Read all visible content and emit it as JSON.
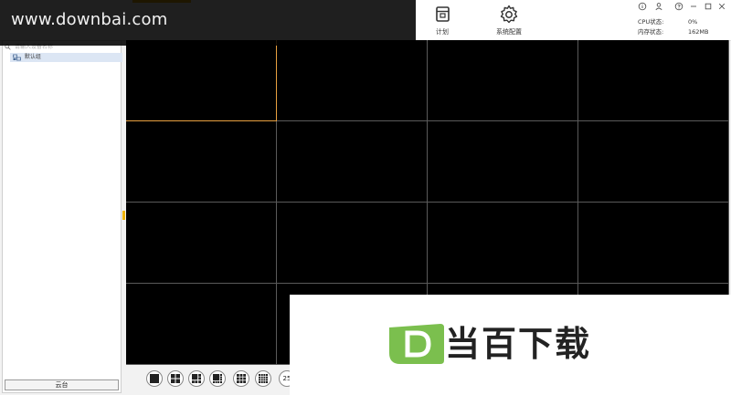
{
  "watermark": {
    "url_text": "www.downbai.com",
    "logo_letter": "D",
    "logo_text": "当百下载"
  },
  "toolbar": {
    "plan_label": "计划",
    "settings_label": "系统配置"
  },
  "status": {
    "cpu_label": "CPU状态:",
    "cpu_value": "0%",
    "mem_label": "内存状态:",
    "mem_value": "162MB"
  },
  "left_panel": {
    "search_placeholder": "请输入设备名称",
    "tree_items": [
      {
        "label": "默认组"
      }
    ],
    "ptz_label": "云台"
  },
  "video_grid": {
    "rows": 4,
    "cols": 4,
    "selected_index": 0
  },
  "layout_bar": {
    "options": [
      {
        "name": "1",
        "icon": "layout-1-icon"
      },
      {
        "name": "4",
        "icon": "layout-4-icon"
      },
      {
        "name": "6",
        "icon": "layout-6-icon"
      },
      {
        "name": "8",
        "icon": "layout-8-icon"
      },
      {
        "name": "9",
        "icon": "layout-9-icon"
      },
      {
        "name": "16",
        "icon": "layout-16-icon"
      }
    ],
    "partial_label": "25"
  },
  "colors": {
    "accent": "#f0b400",
    "selected_border": "#e8a040",
    "grid_line": "#5a5a5a",
    "tree_selected_bg": "#dce6f4",
    "logo_green": "#7bbf4e"
  }
}
